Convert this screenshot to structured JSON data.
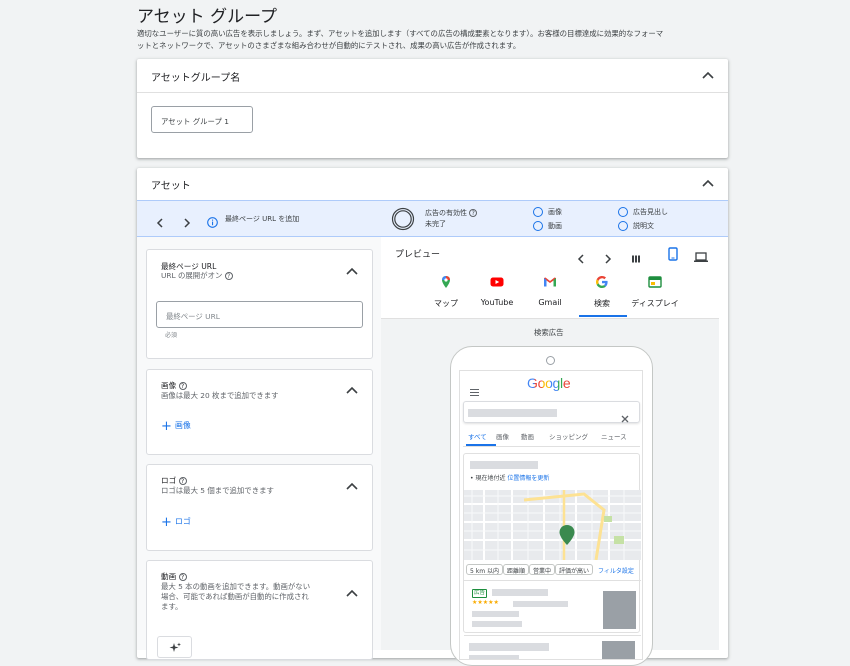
{
  "page": {
    "title": "アセット グループ",
    "description_line1": "適切なユーザーに質の高い広告を表示しましょう。まず、アセットを追加します（すべての広告の構成要素となります）。お客様の目標達成に効果的なフォーマ",
    "description_line2": "ットとネットワークで、アセットのさまざまな組み合わせが自動的にテストされ、成果の高い広告が作成されます。"
  },
  "group_name_card": {
    "title": "アセットグループ名",
    "input_value": "アセット グループ 1"
  },
  "asset_card": {
    "title": "アセット"
  },
  "info_bar": {
    "hint": "最終ページ URL を追加",
    "effectiveness_label": "広告の有効性",
    "effectiveness_status": "未完了",
    "checklist": [
      "画像",
      "動画",
      "広告見出し",
      "説明文"
    ]
  },
  "sections": {
    "final_url": {
      "title": "最終ページ URL",
      "desc": "URL の展開がオン",
      "placeholder": "最終ページ URL",
      "helper": "必須"
    },
    "images": {
      "title": "画像",
      "desc": "画像は最大 20 枚まで追加できます",
      "add": "画像"
    },
    "logos": {
      "title": "ロゴ",
      "desc": "ロゴは最大 5 個まで追加できます",
      "add": "ロゴ"
    },
    "videos": {
      "title": "動画",
      "desc_line1": "最大 5 本の動画を追加できます。動画がない",
      "desc_line2": "場合、可能であれば動画が自動的に作成され",
      "desc_line3": "ます。"
    }
  },
  "preview": {
    "title": "プレビュー",
    "tabs": [
      "マップ",
      "YouTube",
      "Gmail",
      "検索",
      "ディスプレイ"
    ],
    "active_tab": "検索",
    "caption": "検索広告"
  },
  "phone": {
    "logo": "Google",
    "search_tabs": [
      "すべて",
      "画像",
      "動画",
      "ショッピング",
      "ニュース"
    ],
    "location_prefix": "• 現在地付近",
    "location_link": "位置情報を更新",
    "chips": [
      "5 km 以内",
      "距離順",
      "営業中",
      "評価が高い"
    ],
    "filter_link": "フィルタ設定",
    "ad_badge": "広告",
    "stars": "★★★★★"
  },
  "colors": {
    "accent": "#1a73e8",
    "info_bg": "#e8f0fe",
    "page_bg": "#f1f3f4"
  }
}
